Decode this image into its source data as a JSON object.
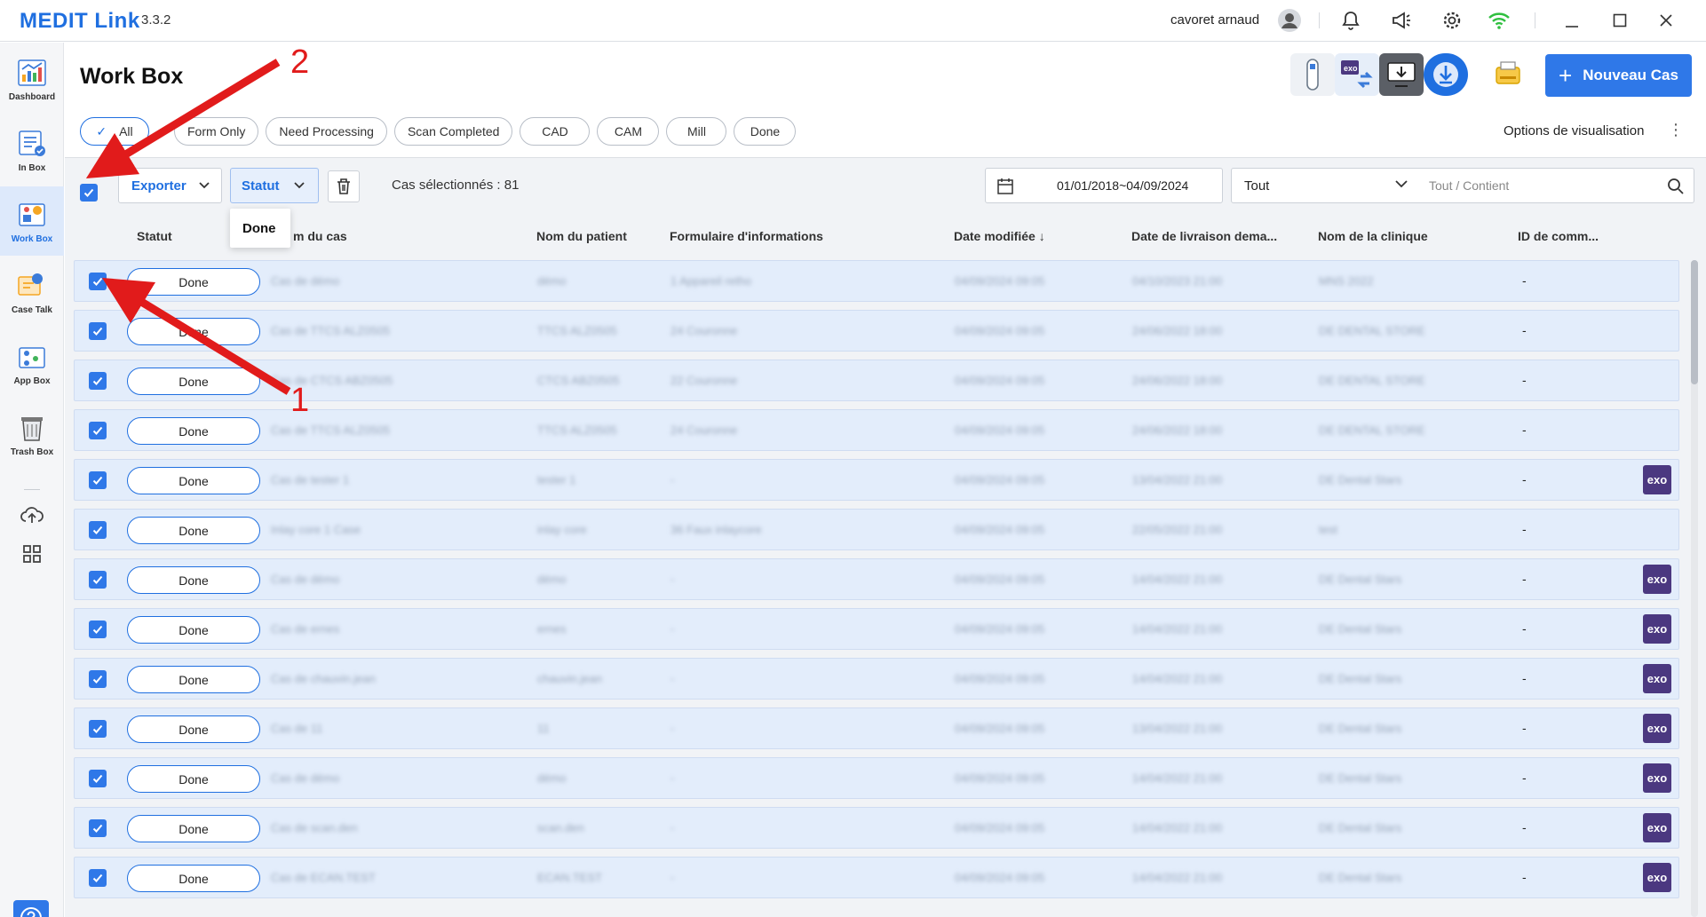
{
  "app": {
    "brand": "MEDIT Link",
    "version": "3.3.2",
    "user_name": "cavoret arnaud"
  },
  "sidebar": {
    "items": [
      {
        "label": "Dashboard",
        "icon": "dashboard-icon"
      },
      {
        "label": "In Box",
        "icon": "in-box-icon"
      },
      {
        "label": "Work Box",
        "icon": "work-box-icon",
        "active": true
      },
      {
        "label": "Case Talk",
        "icon": "case-talk-icon"
      },
      {
        "label": "App Box",
        "icon": "app-box-icon"
      },
      {
        "label": "Trash Box",
        "icon": "trash-box-icon"
      }
    ]
  },
  "header": {
    "title": "Work Box",
    "new_case_label": "Nouveau Cas",
    "view_options_label": "Options de visualisation",
    "exo_label": "exo"
  },
  "filters": [
    "All",
    "Form Only",
    "Need Processing",
    "Scan Completed",
    "CAD",
    "CAM",
    "Mill",
    "Done"
  ],
  "toolbar": {
    "export_label": "Exporter",
    "statut_label": "Statut",
    "selected_count": "Cas sélectionnés : 81",
    "date_range": "01/01/2018~04/09/2024",
    "search_scope": "Tout",
    "search_placeholder": "Tout / Contient",
    "dropdown_option": "Done"
  },
  "table": {
    "columns": [
      "Statut",
      "m du cas",
      "Nom du patient",
      "Formulaire d'informations",
      "Date modifiée",
      "Date de livraison dema...",
      "Nom de la clinique",
      "ID de comm..."
    ],
    "rows": [
      {
        "status": "Done",
        "case": "Cas de démo",
        "patient": "démo",
        "form": "1 Appareil retho",
        "modified": "04/09/2024 09:05",
        "delivery": "04/10/2023 21:00",
        "clinic": "MNS 2022",
        "order": "-",
        "exo": false
      },
      {
        "status": "Done",
        "case": "Cas de TTCS ALZ0505",
        "patient": "TTCS ALZ0505",
        "form": "24 Couronne",
        "modified": "04/09/2024 09:05",
        "delivery": "24/06/2022 18:00",
        "clinic": "DE DENTAL STORE",
        "order": "-",
        "exo": false
      },
      {
        "status": "Done",
        "case": "Cas de CTCS ABZ0505",
        "patient": "CTCS ABZ0505",
        "form": "22 Couronne",
        "modified": "04/09/2024 09:05",
        "delivery": "24/06/2022 18:00",
        "clinic": "DE DENTAL STORE",
        "order": "-",
        "exo": false
      },
      {
        "status": "Done",
        "case": "Cas de TTCS ALZ0505",
        "patient": "TTCS ALZ0505",
        "form": "24 Couronne",
        "modified": "04/09/2024 09:05",
        "delivery": "24/06/2022 18:00",
        "clinic": "DE DENTAL STORE",
        "order": "-",
        "exo": false
      },
      {
        "status": "Done",
        "case": "Cas de tester 1",
        "patient": "tester 1",
        "form": "-",
        "modified": "04/09/2024 09:05",
        "delivery": "13/04/2022 21:00",
        "clinic": "DE Dental Stars",
        "order": "-",
        "exo": true
      },
      {
        "status": "Done",
        "case": "Inlay core 1 Case",
        "patient": "inlay core",
        "form": "36 Faux inlaycore",
        "modified": "04/09/2024 09:05",
        "delivery": "22/05/2022 21:00",
        "clinic": "test",
        "order": "-",
        "exo": false
      },
      {
        "status": "Done",
        "case": "Cas de démo",
        "patient": "démo",
        "form": "-",
        "modified": "04/09/2024 09:05",
        "delivery": "14/04/2022 21:00",
        "clinic": "DE Dental Stars",
        "order": "-",
        "exo": true
      },
      {
        "status": "Done",
        "case": "Cas de ernes",
        "patient": "ernes",
        "form": "-",
        "modified": "04/09/2024 09:05",
        "delivery": "14/04/2022 21:00",
        "clinic": "DE Dental Stars",
        "order": "-",
        "exo": true
      },
      {
        "status": "Done",
        "case": "Cas de chauvin.jean",
        "patient": "chauvin.jean",
        "form": "-",
        "modified": "04/09/2024 09:05",
        "delivery": "14/04/2022 21:00",
        "clinic": "DE Dental Stars",
        "order": "-",
        "exo": true
      },
      {
        "status": "Done",
        "case": "Cas de 11",
        "patient": "11",
        "form": "-",
        "modified": "04/09/2024 09:05",
        "delivery": "13/04/2022 21:00",
        "clinic": "DE Dental Stars",
        "order": "-",
        "exo": true
      },
      {
        "status": "Done",
        "case": "Cas de démo",
        "patient": "démo",
        "form": "-",
        "modified": "04/09/2024 09:05",
        "delivery": "14/04/2022 21:00",
        "clinic": "DE Dental Stars",
        "order": "-",
        "exo": true
      },
      {
        "status": "Done",
        "case": "Cas de scan.den",
        "patient": "scan.den",
        "form": "-",
        "modified": "04/09/2024 09:05",
        "delivery": "14/04/2022 21:00",
        "clinic": "DE Dental Stars",
        "order": "-",
        "exo": true
      },
      {
        "status": "Done",
        "case": "Cas de ECAN.TEST",
        "patient": "ECAN.TEST",
        "form": "-",
        "modified": "04/09/2024 09:05",
        "delivery": "14/04/2022 21:00",
        "clinic": "DE Dental Stars",
        "order": "-",
        "exo": true
      }
    ]
  },
  "annotations": {
    "arrow1": "1",
    "arrow2": "2"
  },
  "colors": {
    "accent": "#2f78e8",
    "row_bg": "#e3edfb",
    "exo": "#4b3880",
    "arrow": "#e11b1b"
  }
}
